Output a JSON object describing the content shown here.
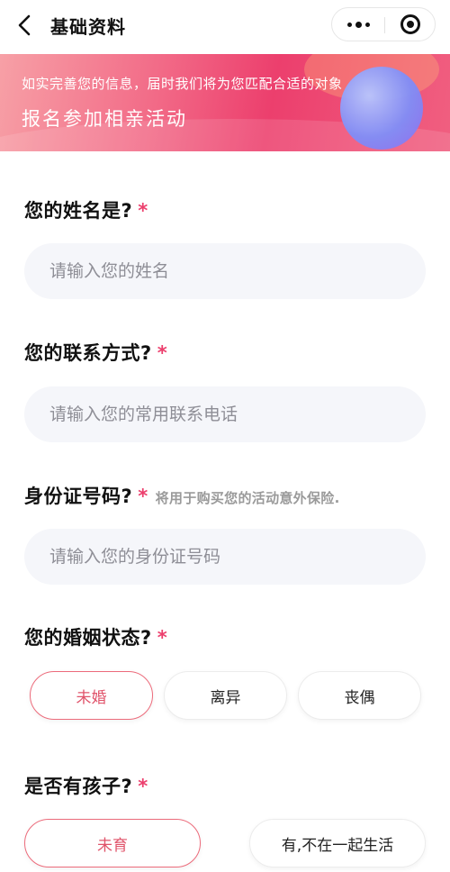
{
  "nav": {
    "title": "基础资料"
  },
  "banner": {
    "subtitle": "如实完善您的信息，届时我们将为您匹配合适的对象",
    "title": "报名参加相亲活动"
  },
  "form": {
    "required_mark": "*",
    "name": {
      "label": "您的姓名是?",
      "placeholder": "请输入您的姓名",
      "value": ""
    },
    "contact": {
      "label": "您的联系方式?",
      "placeholder": "请输入您的常用联系电话",
      "value": ""
    },
    "id_number": {
      "label": "身份证号码?",
      "hint": "将用于购买您的活动意外保险.",
      "placeholder": "请输入您的身份证号码",
      "value": ""
    },
    "marital": {
      "label": "您的婚姻状态?",
      "options": [
        "未婚",
        "离异",
        "丧偶"
      ],
      "selected": "未婚"
    },
    "children": {
      "label": "是否有孩子?",
      "options": [
        "未育",
        "有,不在一起生活"
      ],
      "selected": "未育"
    }
  },
  "colors": {
    "accent": "#ec3f6d",
    "selected_border": "#ec6b7b",
    "input_bg": "#f5f6fa"
  },
  "icons": {
    "back": "chevron-left-icon",
    "more": "more-dots-icon",
    "close": "target-close-icon"
  }
}
